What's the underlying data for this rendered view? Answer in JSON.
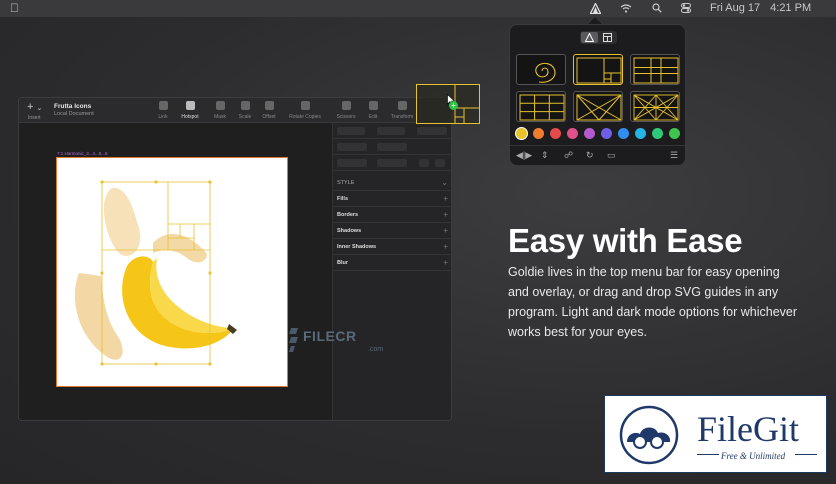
{
  "menubar": {
    "clock_date": "Fri Aug 17",
    "clock_time": "4:21 PM",
    "icons": [
      "apple-icon",
      "goldie-icon",
      "wifi-icon",
      "search-icon",
      "control-center-icon"
    ]
  },
  "app": {
    "insert_label": "Insert",
    "doc_title": "Frutta Icons",
    "doc_subtitle": "Local Document",
    "tools": [
      "Link",
      "Hotspot",
      "Mask",
      "Scale",
      "Offset",
      "Rotate Copies",
      "Scissors",
      "Edit",
      "Transform"
    ],
    "active_tool": "Hotspot",
    "artboard_label": "7:1 Harmonic_3...4...5...6",
    "inspector": {
      "style_header": "STYLE",
      "sections": [
        "Fills",
        "Borders",
        "Shadows",
        "Inner Shadows",
        "Blur"
      ]
    }
  },
  "watermark": {
    "name": "FILECR",
    "suffix": ".com"
  },
  "popover": {
    "selected_guide": 1,
    "colors": [
      "#e8c22a",
      "#ee7d2f",
      "#e44c4c",
      "#e0508a",
      "#b45ad1",
      "#6f5ee8",
      "#2f8ef0",
      "#25b5e5",
      "#2fca78",
      "#3fc450",
      "#6a6a6a"
    ],
    "selected_color": 0
  },
  "hero": {
    "title": "Easy with Ease",
    "body": "Goldie lives in the top menu bar for easy opening and overlay, or drag and drop SVG guides in any program. Light and dark mode options for whichever works best for your eyes."
  },
  "badge": {
    "name": "FileGit",
    "tagline": "Free & Unlimited"
  },
  "colors": {
    "accent_gold": "#e7c12f",
    "artboard_border": "#e07a2a",
    "badge_blue": "#1f3a6a"
  }
}
